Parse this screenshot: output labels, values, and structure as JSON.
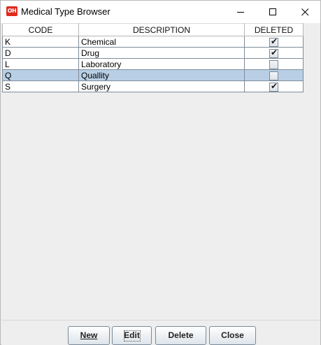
{
  "window": {
    "title": "Medical Type Browser",
    "icon_text": "OH",
    "icon_color": "#e02a1d",
    "controls": [
      "minimize-icon",
      "maximize-icon",
      "close-icon"
    ]
  },
  "table": {
    "columns": [
      "CODE",
      "DESCRIPTION",
      "DELETED"
    ],
    "rows": [
      {
        "code": "K",
        "description": "Chemical",
        "deleted": true
      },
      {
        "code": "D",
        "description": "Drug",
        "deleted": true
      },
      {
        "code": "L",
        "description": "Laboratory",
        "deleted": false
      },
      {
        "code": "Q",
        "description": "Quallity",
        "deleted": false,
        "selected": true
      },
      {
        "code": "S",
        "description": "Surgery",
        "deleted": true
      }
    ],
    "selected_row_color": "#b8cfe5"
  },
  "buttons": {
    "new_label": "New",
    "edit_label": "Edit",
    "delete_label": "Delete",
    "close_label": "Close"
  }
}
